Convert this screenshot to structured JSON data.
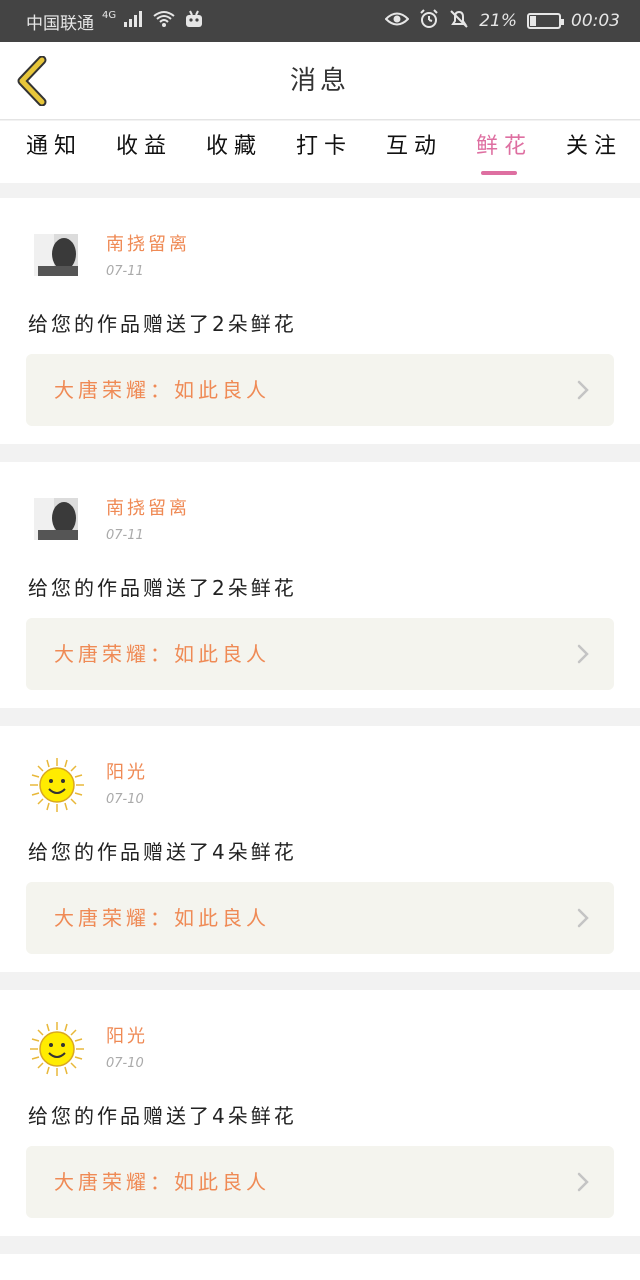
{
  "status_bar": {
    "carrier": "中国联通",
    "network": "4G",
    "battery": "21%",
    "battery_level": 0.21,
    "time": "00:03"
  },
  "header": {
    "title": "消息"
  },
  "tabs": [
    {
      "label": "通知",
      "active": false
    },
    {
      "label": "收益",
      "active": false
    },
    {
      "label": "收藏",
      "active": false
    },
    {
      "label": "打卡",
      "active": false
    },
    {
      "label": "互动",
      "active": false
    },
    {
      "label": "鲜花",
      "active": true
    },
    {
      "label": "关注",
      "active": false
    }
  ],
  "messages": [
    {
      "user": "南挠留离",
      "avatar": "photo-avatar",
      "date": "07-11",
      "text": "给您的作品赠送了2朵鲜花",
      "work": "大唐荣耀：如此良人"
    },
    {
      "user": "南挠留离",
      "avatar": "photo-avatar",
      "date": "07-11",
      "text": "给您的作品赠送了2朵鲜花",
      "work": "大唐荣耀：如此良人"
    },
    {
      "user": "阳光",
      "avatar": "sun-avatar",
      "date": "07-10",
      "text": "给您的作品赠送了4朵鲜花",
      "work": "大唐荣耀：如此良人"
    },
    {
      "user": "阳光",
      "avatar": "sun-avatar",
      "date": "07-10",
      "text": "给您的作品赠送了4朵鲜花",
      "work": "大唐荣耀：如此良人"
    }
  ],
  "colors": {
    "accent": "#de6fa1",
    "username": "#ef8a55",
    "link_bg": "#f4f4ee",
    "status_bar": "#444444",
    "back_arrow": "#e7c63a"
  }
}
